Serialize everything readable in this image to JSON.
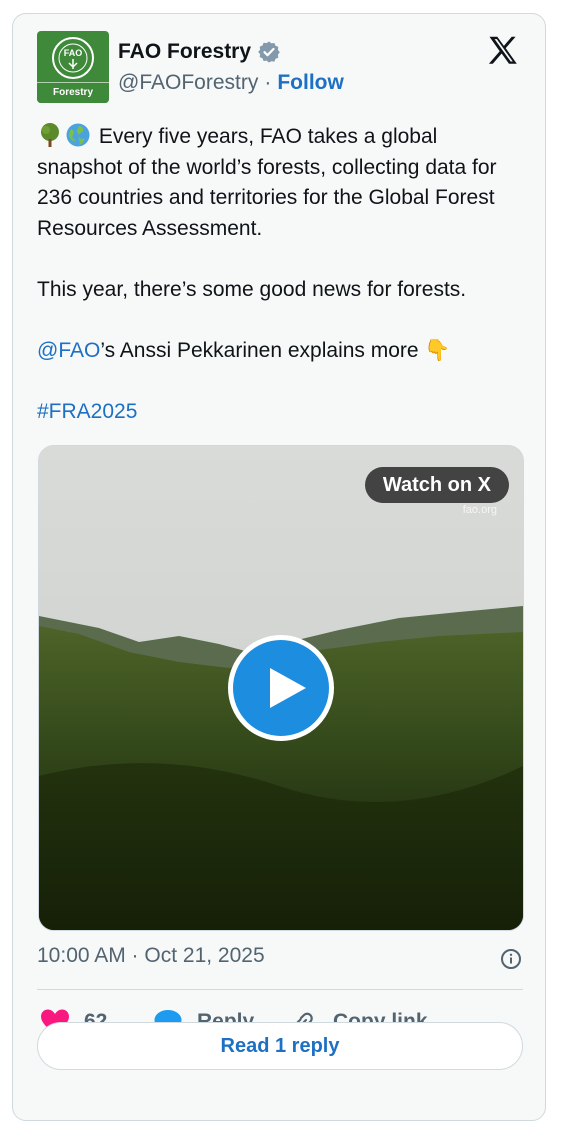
{
  "author": {
    "name": "FAO Forestry",
    "handle": "@FAOForestry",
    "separator": "·",
    "follow_label": "Follow",
    "avatar_label": "Forestry",
    "avatar_logo_text": "FAO",
    "verified": true
  },
  "icons": {
    "verified": "verified-badge-icon",
    "platform": "x-logo-icon",
    "info": "info-icon",
    "like": "heart-icon",
    "reply": "speech-bubble-icon",
    "copy": "link-icon",
    "play": "play-icon"
  },
  "tweet": {
    "line1": "Every five years, FAO takes a global snapshot of the world’s forests, collecting data for 236 countries and territories for the Global Forest Resources Assessment.",
    "line2": "This year, there’s some good news for forests.",
    "mention": "@FAO",
    "line3_rest": "’s Anssi Pekkarinen explains more 👇",
    "hashtag": "#FRA2025"
  },
  "media": {
    "watch_label": "Watch on X",
    "watermark": "fao.org"
  },
  "meta": {
    "timestamp": "10:00 AM · Oct 21, 2025"
  },
  "actions": {
    "like_count": "62",
    "reply_label": "Reply",
    "copy_label": "Copy link"
  },
  "read_replies_label": "Read 1 reply",
  "colors": {
    "link": "#1d70c4",
    "like": "#f91880",
    "reply": "#1d9bf0",
    "avatar_bg": "#3f8a3a"
  }
}
